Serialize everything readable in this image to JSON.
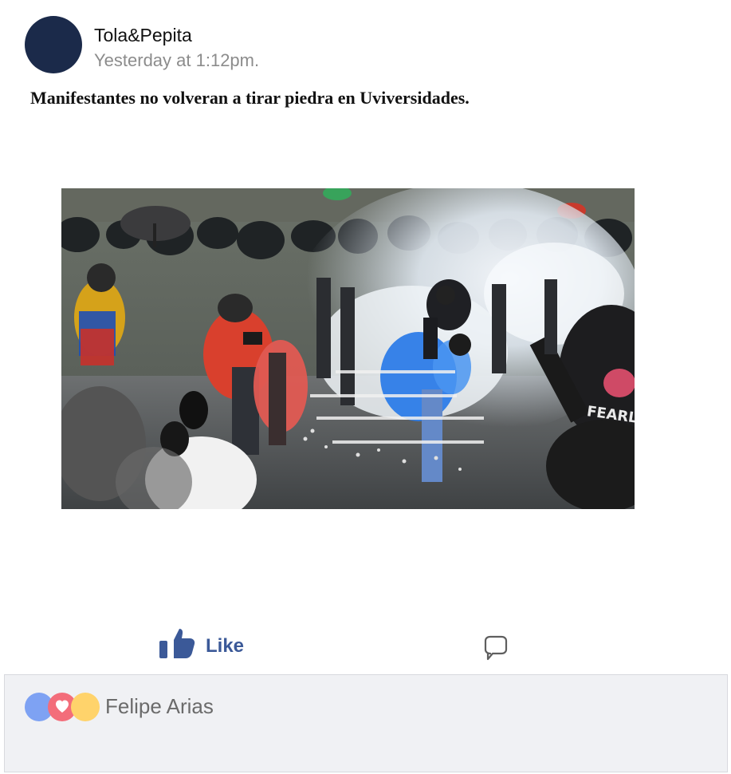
{
  "post": {
    "author": "Tola&Pepita",
    "timestamp": "Yesterday at 1:12pm.",
    "text": "Manifestantes no volveran a tirar piedra en Uviversidades."
  },
  "media": {
    "alt_icon": "protest-photo",
    "shirt_text": "FEARLES"
  },
  "actions": {
    "like_label": "Like",
    "like_icon": "thumbs-up-icon",
    "comment_icon": "comment-icon"
  },
  "reactions": {
    "names": "Felipe Arias",
    "icons": [
      "like-reaction-icon",
      "love-reaction-icon",
      "haha-reaction-icon"
    ]
  },
  "colors": {
    "avatar": "#1b2a4a",
    "brand_blue": "#3b5998",
    "like_dot": "#7ea2f3",
    "love_dot": "#f36d7a",
    "haha_dot": "#ffd36b",
    "panel_bg": "#f0f1f4"
  }
}
